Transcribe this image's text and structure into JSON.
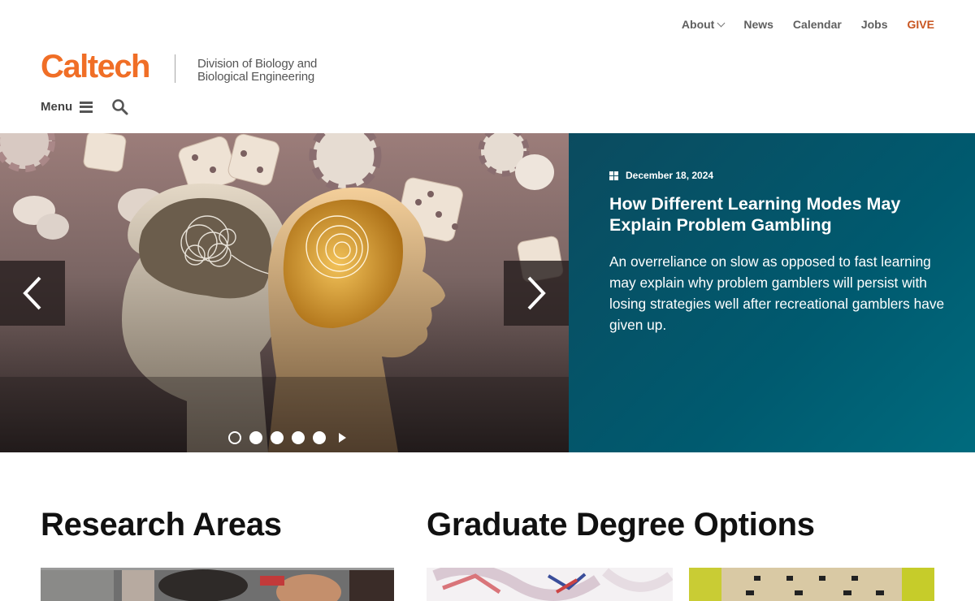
{
  "topnav": {
    "about": "About",
    "news": "News",
    "calendar": "Calendar",
    "jobs": "Jobs",
    "give": "GIVE"
  },
  "header": {
    "logo": "Caltech",
    "division_line1": "Division of Biology and",
    "division_line2": "Biological Engineering",
    "menu_label": "Menu"
  },
  "hero": {
    "date": "December 18, 2024",
    "title": "How Different Learning Modes May Explain Problem Gambling",
    "summary": "An overreliance on slow as opposed to fast learning may explain why problem gamblers will persist with losing strategies well after recreational gamblers have given up.",
    "active_slide": 1,
    "slide_count": 5
  },
  "sections": {
    "research": "Research Areas",
    "graduate": "Graduate Degree Options"
  },
  "icons": {
    "about_dropdown": "chevron-down-icon",
    "menu": "hamburger-icon",
    "search": "search-icon",
    "prev": "chevron-left-icon",
    "next": "chevron-right-icon",
    "date": "grid-icon",
    "play": "play-icon"
  },
  "colors": {
    "brand_orange": "#f06e26",
    "give": "#c8541f",
    "panel_teal": "#005a6f"
  }
}
